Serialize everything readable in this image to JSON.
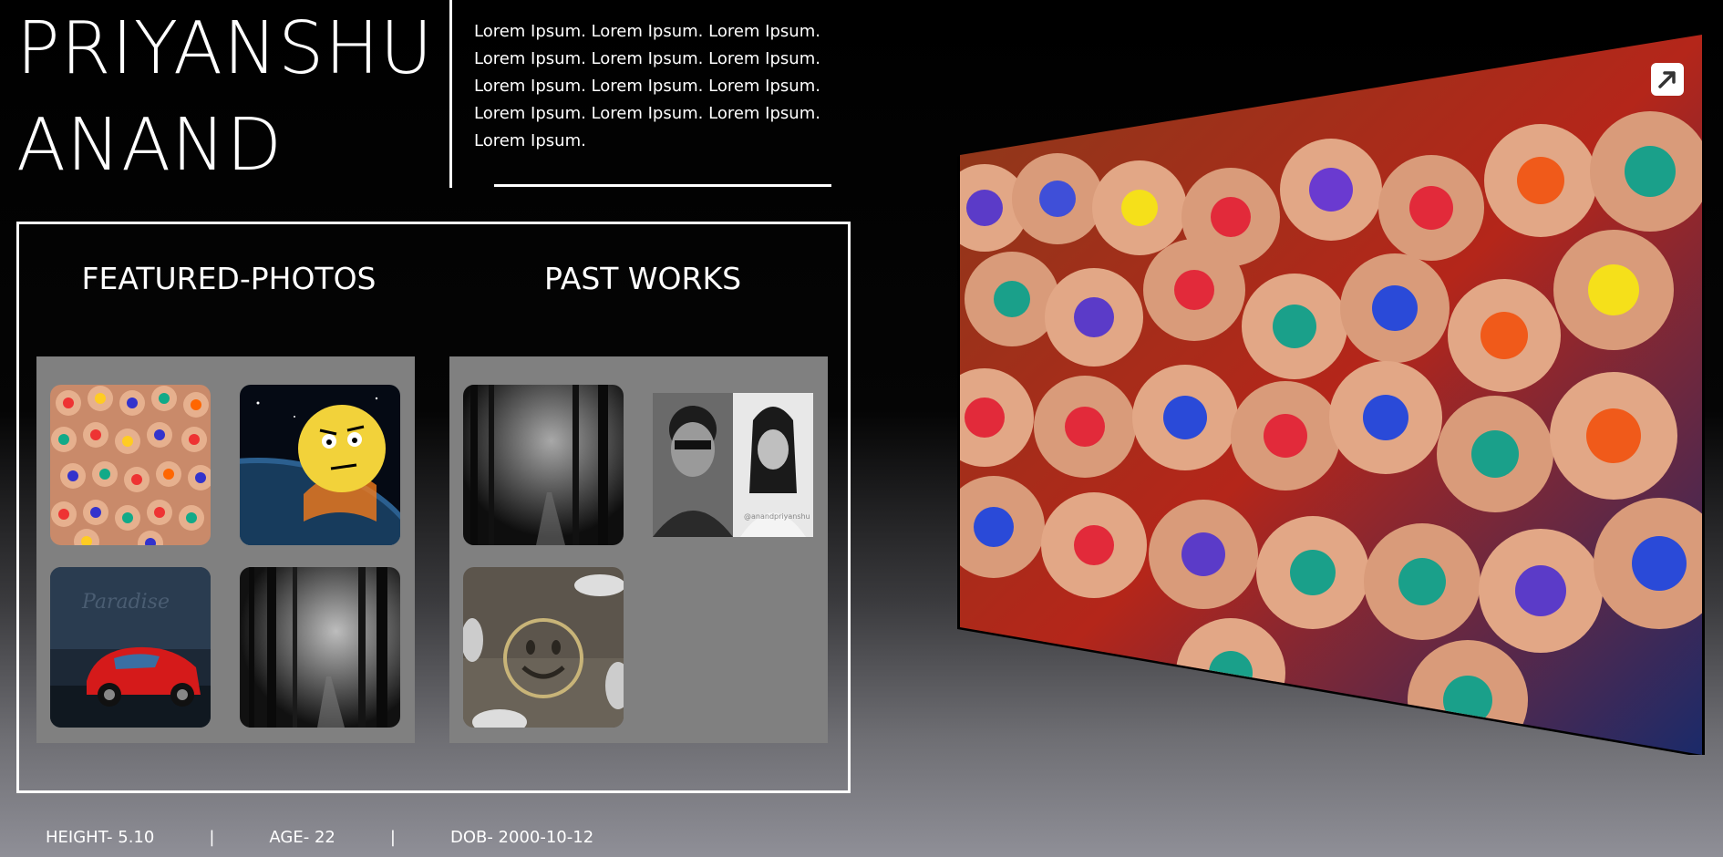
{
  "header": {
    "name_line1": "PRIYANSHU",
    "name_line2": "ANAND",
    "intro": "Lorem Ipsum. Lorem Ipsum. Lorem Ipsum. Lorem Ipsum. Lorem Ipsum. Lorem Ipsum. Lorem Ipsum. Lorem Ipsum. Lorem Ipsum. Lorem Ipsum. Lorem Ipsum. Lorem Ipsum. Lorem Ipsum."
  },
  "featured": {
    "title": "FEATURED-PHOTOS",
    "photos": [
      "colored-pencils",
      "emoji-earth",
      "red-car",
      "dark-forest"
    ]
  },
  "past_works": {
    "title": "PAST WORKS",
    "photos": [
      "dark-forest",
      "portrait-pair",
      "smiley-pavement"
    ],
    "watermark": "@anandpriyanshu"
  },
  "stats": {
    "height": "HEIGHT- 5.10",
    "age": "AGE- 22",
    "dob": "DOB- 2000-10-12",
    "separator": "|"
  },
  "hero": {
    "image": "colored-pencils-closeup"
  },
  "icons": {
    "expand": "expand-arrow-icon"
  }
}
